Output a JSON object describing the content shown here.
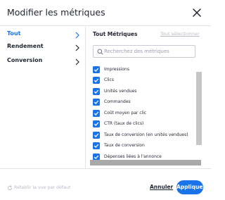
{
  "dialog": {
    "title": "Modifier les métriques",
    "close_icon": "close-icon"
  },
  "sidebar": {
    "items": [
      {
        "label": "Tout",
        "active": true
      },
      {
        "label": "Rendement",
        "active": false
      },
      {
        "label": "Conversion",
        "active": false
      }
    ]
  },
  "panel": {
    "title": "Tout Métriques",
    "select_all": "Tout sélectionner",
    "search_placeholder": "Recherchez des métriques",
    "metrics": [
      {
        "label": "Impressions",
        "checked": true
      },
      {
        "label": "Clics",
        "checked": true
      },
      {
        "label": "Unités vendues",
        "checked": true
      },
      {
        "label": "Commandes",
        "checked": true
      },
      {
        "label": "Coût moyen par clic",
        "checked": true
      },
      {
        "label": "CTR (taux de clics)",
        "checked": true
      },
      {
        "label": "Taux de conversion (en unités vendues)",
        "checked": true
      },
      {
        "label": "Taux de conversion",
        "checked": true
      },
      {
        "label": "Dépenses liées à l'annonce",
        "checked": true
      }
    ]
  },
  "footer": {
    "reset_label": "Rétablir la vue par défaut",
    "cancel_label": "Annuler",
    "apply_label": "Appliquer"
  },
  "colors": {
    "accent": "#1a73e8",
    "text": "#1f2430",
    "muted": "#b9bcc6"
  }
}
